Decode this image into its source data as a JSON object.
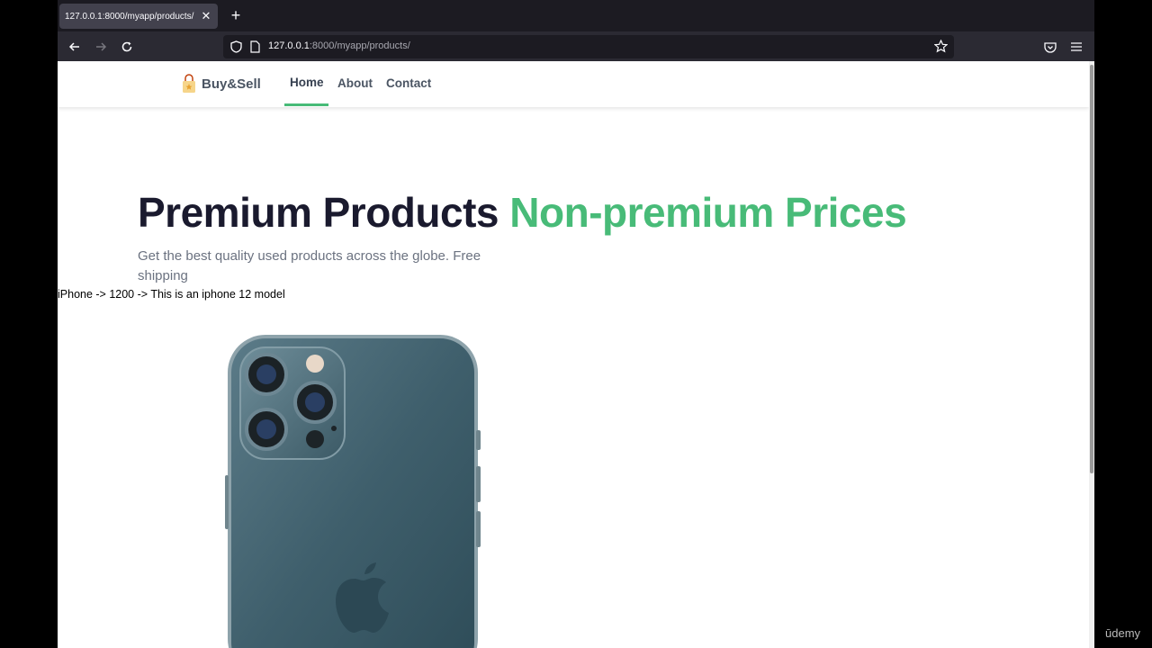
{
  "browser": {
    "tab_title": "127.0.0.1:8000/myapp/products/",
    "url_host": "127.0.0.1",
    "url_path": ":8000/myapp/products/"
  },
  "navbar": {
    "brand": "Buy&Sell",
    "links": [
      {
        "label": "Home",
        "active": true
      },
      {
        "label": "About",
        "active": false
      },
      {
        "label": "Contact",
        "active": false
      }
    ]
  },
  "hero": {
    "title": "Premium Products",
    "title_accent": "Non-premium Prices",
    "subtitle": "Get the best quality used products across the globe. Free shipping"
  },
  "product": {
    "line": "iPhone -> 1200 -> This is an iphone 12 model",
    "image": "iphone-12-pro-back"
  },
  "watermark": "ūdemy",
  "colors": {
    "accent": "#48bb78",
    "title": "#1a1a2e",
    "tab_bg": "#42414d",
    "toolbar_bg": "#2b2a33"
  }
}
